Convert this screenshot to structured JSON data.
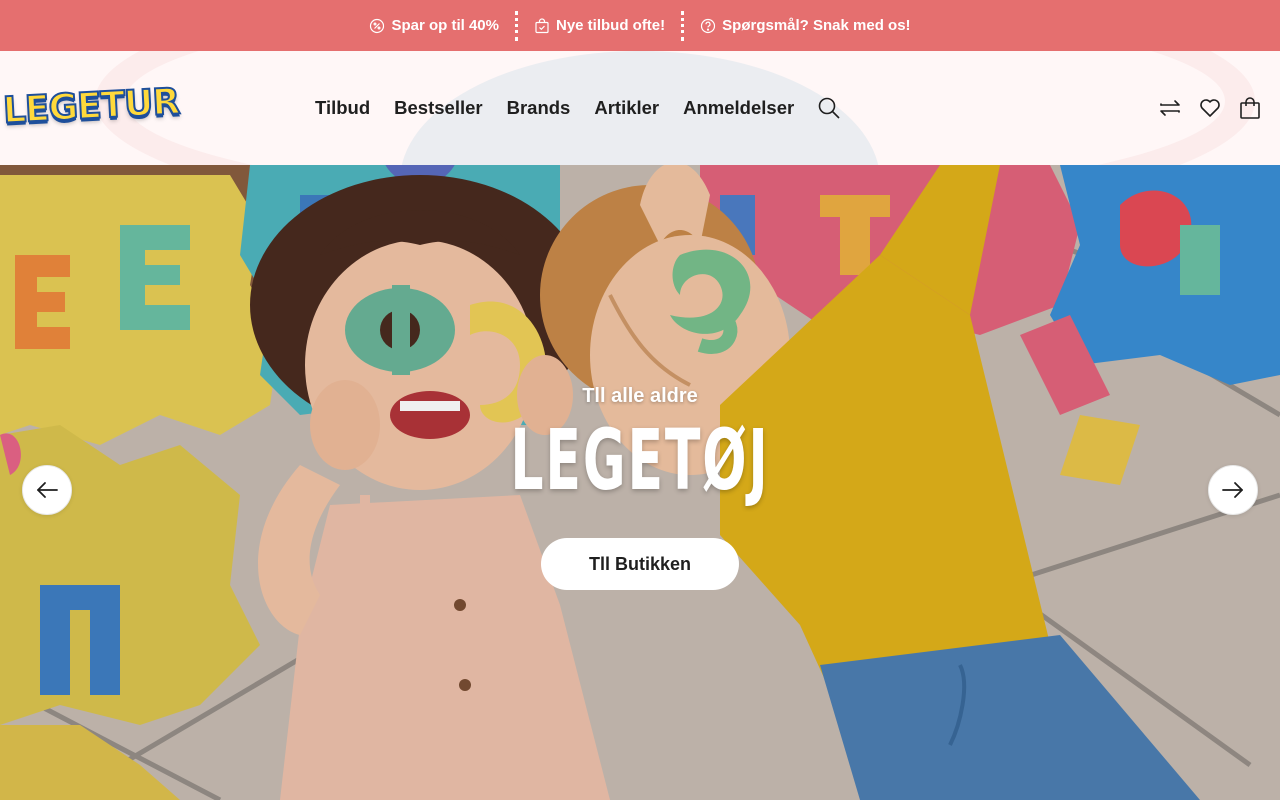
{
  "announcement": {
    "items": [
      {
        "icon": "percent-badge-icon",
        "text": "Spar op til 40%"
      },
      {
        "icon": "shopping-bag-check-icon",
        "text": "Nye tilbud ofte!"
      },
      {
        "icon": "question-circle-icon",
        "text": "Spørgsmål? Snak med os!"
      }
    ],
    "background": "#e56f6f"
  },
  "header": {
    "logo_text": "LEGETUR",
    "nav": [
      "Tilbud",
      "Bestseller",
      "Brands",
      "Artikler",
      "Anmeldelser"
    ],
    "icons": [
      "search-icon",
      "compare-icon",
      "heart-icon",
      "shopping-bag-icon"
    ]
  },
  "hero": {
    "subtitle": "Tll alle aldre",
    "title": "LEGETØJ",
    "cta": "Tll Butikken",
    "prev_icon": "arrow-left-icon",
    "next_icon": "arrow-right-icon"
  },
  "colors": {
    "accent": "#e56f6f",
    "text_dark": "#1f1f1f",
    "header_bg": "#fff6f6"
  }
}
